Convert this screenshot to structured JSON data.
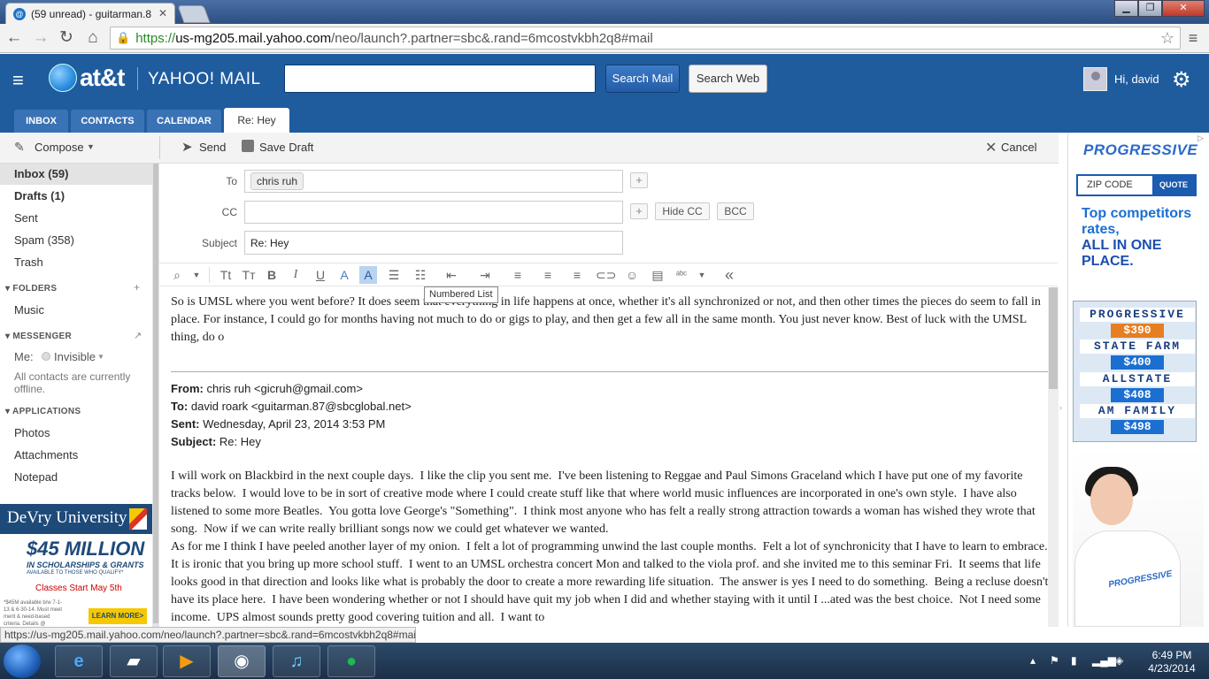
{
  "browser": {
    "tab_title": "(59 unread) - guitarman.8",
    "url_https": "https://",
    "url_domain": "us-mg205.mail.yahoo.com",
    "url_path": "/neo/launch?.partner=sbc&.rand=6mcostvkbh2q8#mail",
    "status_url": "https://us-mg205.mail.yahoo.com/neo/launch?.partner=sbc&.rand=6mcostvkbh2q8#mail"
  },
  "header": {
    "brand_att": "at&t",
    "brand_mail": "YAHOO! MAIL",
    "search_mail_label": "Search Mail",
    "search_web_label": "Search Web",
    "greeting": "Hi, david"
  },
  "nav": {
    "tabs": [
      "INBOX",
      "CONTACTS",
      "CALENDAR"
    ],
    "active_tab": "Re: Hey"
  },
  "toolbar": {
    "compose": "Compose",
    "send": "Send",
    "save_draft": "Save Draft",
    "cancel": "Cancel"
  },
  "sidebar": {
    "folders": [
      {
        "label": "Inbox (59)"
      },
      {
        "label": "Drafts (1)"
      },
      {
        "label": "Sent"
      },
      {
        "label": "Spam (358)"
      },
      {
        "label": "Trash"
      }
    ],
    "folders_header": "FOLDERS",
    "custom_folders": [
      "Music"
    ],
    "messenger_header": "MESSENGER",
    "me_label": "Me:",
    "status": "Invisible",
    "offline_note": "All contacts are currently offline.",
    "applications_header": "APPLICATIONS",
    "apps": [
      "Photos",
      "Attachments",
      "Notepad"
    ]
  },
  "compose": {
    "to_label": "To",
    "to_value": "chris ruh",
    "cc_label": "CC",
    "subject_label": "Subject",
    "subject_value": "Re: Hey",
    "hide_cc": "Hide CC",
    "bcc": "BCC",
    "tooltip": "Numbered List",
    "reply_text": "So is UMSL where you went before? It does seem that everything in life happens at once, whether it's all synchronized or not, and then other times the pieces do seem to fall in place. For instance, I could go for months having not much to do or gigs to play, and then get a few all in the same month. You just never know. Best of luck with the UMSL thing, do o"
  },
  "quoted": {
    "from_label": "From:",
    "from_value": "chris ruh <gicruh@gmail.com>",
    "to_label": "To:",
    "to_value": "david roark <guitarman.87@sbcglobal.net>",
    "sent_label": "Sent:",
    "sent_value": "Wednesday, April 23, 2014 3:53 PM",
    "subject_label": "Subject:",
    "subject_value": "Re: Hey",
    "body": "I will work on Blackbird in the next couple days.  I like the clip you sent me.  I've been listening to Reggae and Paul Simons Graceland which I have put one of my favorite tracks below.  I would love to be in sort of creative mode where I could create stuff like that where world music influences are incorporated in one's own style.  I have also listened to some more Beatles.  You gotta love George's \"Something\".  I think most anyone who has felt a really strong attraction towards a woman has wished they wrote that song.  Now if we can write really brilliant songs now we could get whatever we wanted.\nAs for me I think I have peeled another layer of my onion.  I felt a lot of programming unwind the last couple months.  Felt a lot of synchronicity that I have to learn to embrace.\nIt is ironic that you bring up more school stuff.  I went to an UMSL orchestra concert Mon and talked to the viola prof. and she invited me to this seminar Fri.  It seems that life looks good in that direction and looks like what is probably the door to create a more rewarding life situation.  The answer is yes I need to do something.  Being a recluse doesn't have its place here.  I have been wondering whether or not I should have quit my job when I did and whether staying with it until I ...ated was the best choice.  Not I need some income.  UPS almost sounds pretty good covering tuition and all.  I want to"
  },
  "ad_left": {
    "brand": "DeVry University",
    "amount": "$45 MILLION",
    "scholarships": "IN SCHOLARSHIPS & GRANTS",
    "available": "AVAILABLE TO THOSE WHO QUALIFY*",
    "classes": "Classes Start May 5th",
    "fine_print": "*$45M available b/w 7-1-13 & 6-30-14. Must meet merit & need-based criteria. Details @",
    "cta": "LEARN MORE>"
  },
  "ad_right": {
    "brand": "PROGRESSIVE",
    "zip_label": "ZIP CODE",
    "quote_btn": "QUOTE",
    "tagline_1": "Top competitors rates,",
    "tagline_2": "ALL IN ONE PLACE.",
    "rates": [
      {
        "brand": "PROGRESSIVE",
        "price": "$390"
      },
      {
        "brand": "STATE FARM",
        "price": "$400"
      },
      {
        "brand": "ALLSTATE",
        "price": "$408"
      },
      {
        "brand": "AM FAMILY",
        "price": "$498"
      }
    ],
    "shirt_logo": "PROGRESSIVE"
  },
  "taskbar": {
    "time": "6:49 PM",
    "date": "4/23/2014"
  },
  "colors": {
    "yahoo_blue": "#1f5c9e",
    "tab_blue": "#3a73b5",
    "progressive_blue": "#1b6fd0"
  }
}
